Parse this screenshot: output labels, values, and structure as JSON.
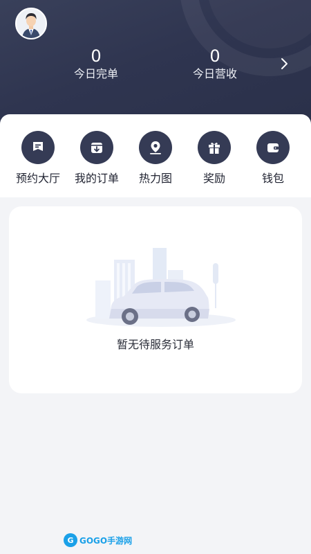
{
  "header": {
    "stats": [
      {
        "value": "0",
        "label": "今日完单"
      },
      {
        "value": "0",
        "label": "今日营收"
      }
    ]
  },
  "menu": [
    {
      "label": "预约大厅",
      "icon": "reservation-hall-icon"
    },
    {
      "label": "我的订单",
      "icon": "my-orders-icon"
    },
    {
      "label": "热力图",
      "icon": "heatmap-pin-icon"
    },
    {
      "label": "奖励",
      "icon": "gift-icon"
    },
    {
      "label": "钱包",
      "icon": "wallet-icon"
    }
  ],
  "orders": {
    "empty_text": "暂无待服务订单"
  },
  "watermark": {
    "logo": "G",
    "text": "GOGO手游网"
  },
  "colors": {
    "header_dark": "#2f3550",
    "icon_circle": "#353b55",
    "page_bg": "#f3f4f7",
    "watermark_blue": "#1aa0e8"
  }
}
